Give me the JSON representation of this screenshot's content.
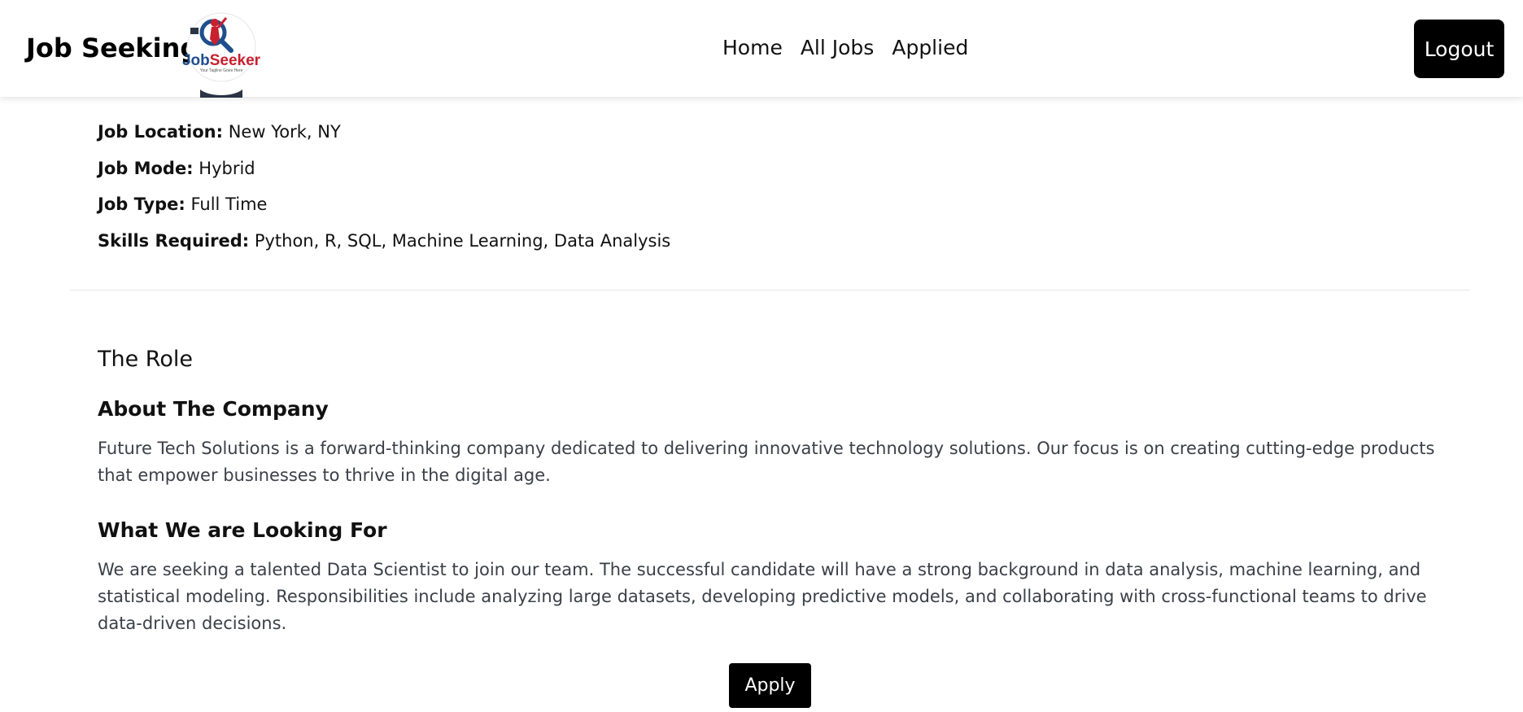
{
  "header": {
    "brand": "Job Seeking",
    "logo": {
      "name": "JobSeeker",
      "tagline": "Your Tagline Goes Here"
    },
    "nav": [
      "Home",
      "All Jobs",
      "Applied"
    ],
    "logout_label": "Logout"
  },
  "job": {
    "details": [
      {
        "label": "Job Location:",
        "value": "New York, NY"
      },
      {
        "label": "Job Mode:",
        "value": "Hybrid"
      },
      {
        "label": "Job Type:",
        "value": "Full Time"
      },
      {
        "label": "Skills Required:",
        "value": "Python, R, SQL, Machine Learning, Data Analysis"
      }
    ],
    "role_heading": "The Role",
    "about_heading": "About The Company",
    "about_text": "Future Tech Solutions is a forward-thinking company dedicated to delivering innovative technology solutions. Our focus is on creating cutting-edge products that empower businesses to thrive in the digital age.",
    "looking_heading": "What We are Looking For",
    "looking_text": "We are seeking a talented Data Scientist to join our team. The successful candidate will have a strong background in data analysis, machine learning, and statistical modeling. Responsibilities include analyzing large datasets, developing predictive models, and collaborating with cross-functional teams to drive data-driven decisions.",
    "apply_label": "Apply"
  },
  "colors": {
    "button_bg": "#000000",
    "body_text": "#3b3f47",
    "logo_blue": "#1f4e8c",
    "logo_red": "#c8202f"
  }
}
